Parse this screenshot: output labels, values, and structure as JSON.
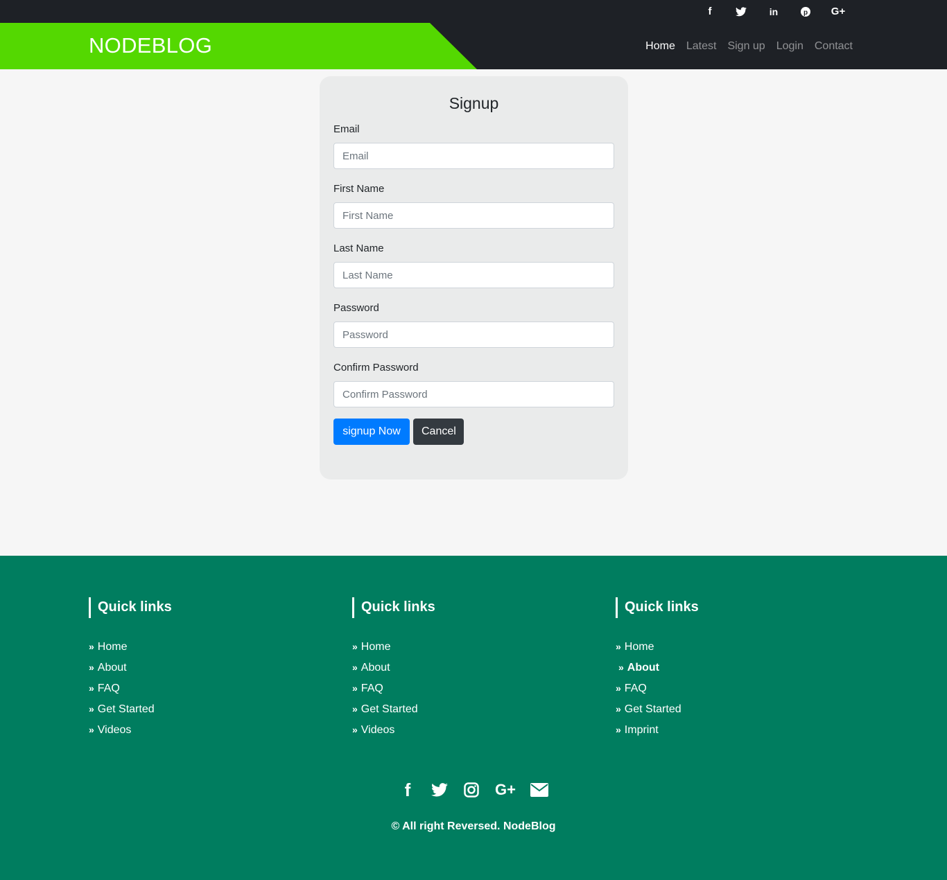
{
  "topbar": {
    "social": [
      {
        "icon": "facebook-icon",
        "glyph": "f"
      },
      {
        "icon": "twitter-icon",
        "glyph": "🐦"
      },
      {
        "icon": "linkedin-icon",
        "glyph": "in"
      },
      {
        "icon": "pinterest-icon",
        "glyph": "℗"
      },
      {
        "icon": "google-plus-icon",
        "glyph": "G+"
      }
    ]
  },
  "navbar": {
    "brand": "NODEBLOG",
    "links": [
      "Home",
      "Latest",
      "Sign up",
      "Login",
      "Contact"
    ],
    "active": "Home"
  },
  "form": {
    "title": "Signup",
    "fields": [
      {
        "label": "Email",
        "placeholder": "Email"
      },
      {
        "label": "First Name",
        "placeholder": "First Name"
      },
      {
        "label": "Last Name",
        "placeholder": "Last Name"
      },
      {
        "label": "Password",
        "placeholder": "Password"
      },
      {
        "label": "Confirm Password",
        "placeholder": "Confirm Password"
      }
    ],
    "submit_label": "signup Now",
    "cancel_label": "Cancel"
  },
  "footer": {
    "columns": [
      {
        "title": "Quick links",
        "links": [
          "Home",
          "About",
          "FAQ",
          "Get Started",
          "Videos"
        ]
      },
      {
        "title": "Quick links",
        "links": [
          "Home",
          "About",
          "FAQ",
          "Get Started",
          "Videos"
        ]
      },
      {
        "title": "Quick links",
        "links": [
          "Home",
          "About",
          "FAQ",
          "Get Started",
          "Imprint"
        ]
      }
    ],
    "social": [
      {
        "icon": "facebook-icon",
        "glyph": "f"
      },
      {
        "icon": "twitter-icon",
        "glyph": "🐦"
      },
      {
        "icon": "instagram-icon",
        "glyph": "◎"
      },
      {
        "icon": "google-plus-icon",
        "glyph": "G+"
      },
      {
        "icon": "envelope-icon",
        "glyph": "✉"
      }
    ],
    "copyright": "© All right Reversed.  NodeBlog"
  },
  "colors": {
    "brand_green": "#54d801",
    "nav_dark": "#1e2126",
    "footer_green": "#007d5f",
    "primary": "#007bff"
  }
}
